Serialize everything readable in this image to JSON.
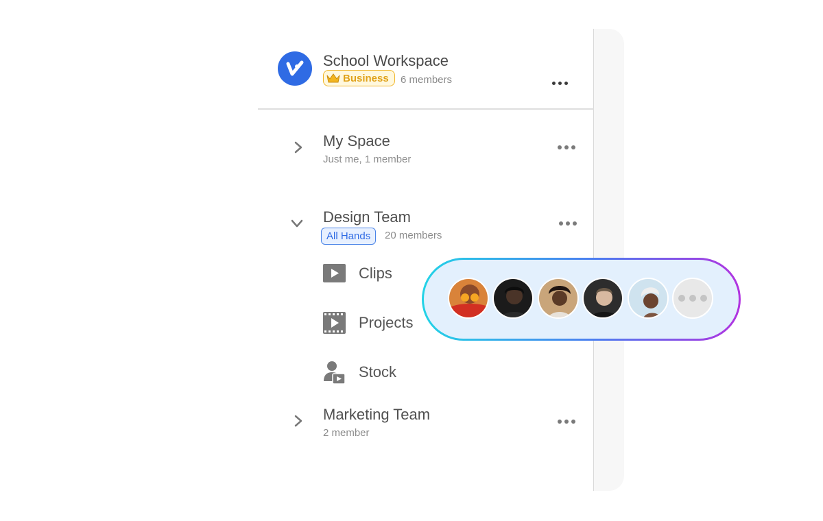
{
  "workspace": {
    "title": "School Workspace",
    "plan": "Business",
    "members": "6 members"
  },
  "spaces": [
    {
      "title": "My Space",
      "subtitle": "Just me, 1 member",
      "expanded": false
    },
    {
      "title": "Design Team",
      "badge": "All Hands",
      "subtitle": "20 members",
      "expanded": true,
      "children": [
        {
          "label": "Clips",
          "icon": "play-icon"
        },
        {
          "label": "Projects",
          "icon": "film-icon"
        },
        {
          "label": "Stock",
          "icon": "stock-person-icon"
        }
      ]
    },
    {
      "title": "Marketing Team",
      "subtitle": "2 member",
      "expanded": false
    }
  ],
  "colors": {
    "brand": "#2f6be4",
    "business_badge": "#f1b62a",
    "all_hands_badge": "#4a84e8",
    "pill_gradient": [
      "#22d3e6",
      "#4d7cf0",
      "#b233e0"
    ]
  },
  "avatars_pill": {
    "avatars": [
      "avatar-1",
      "avatar-2",
      "avatar-3",
      "avatar-4",
      "avatar-5"
    ],
    "more_icon": "more-dots-icon"
  }
}
